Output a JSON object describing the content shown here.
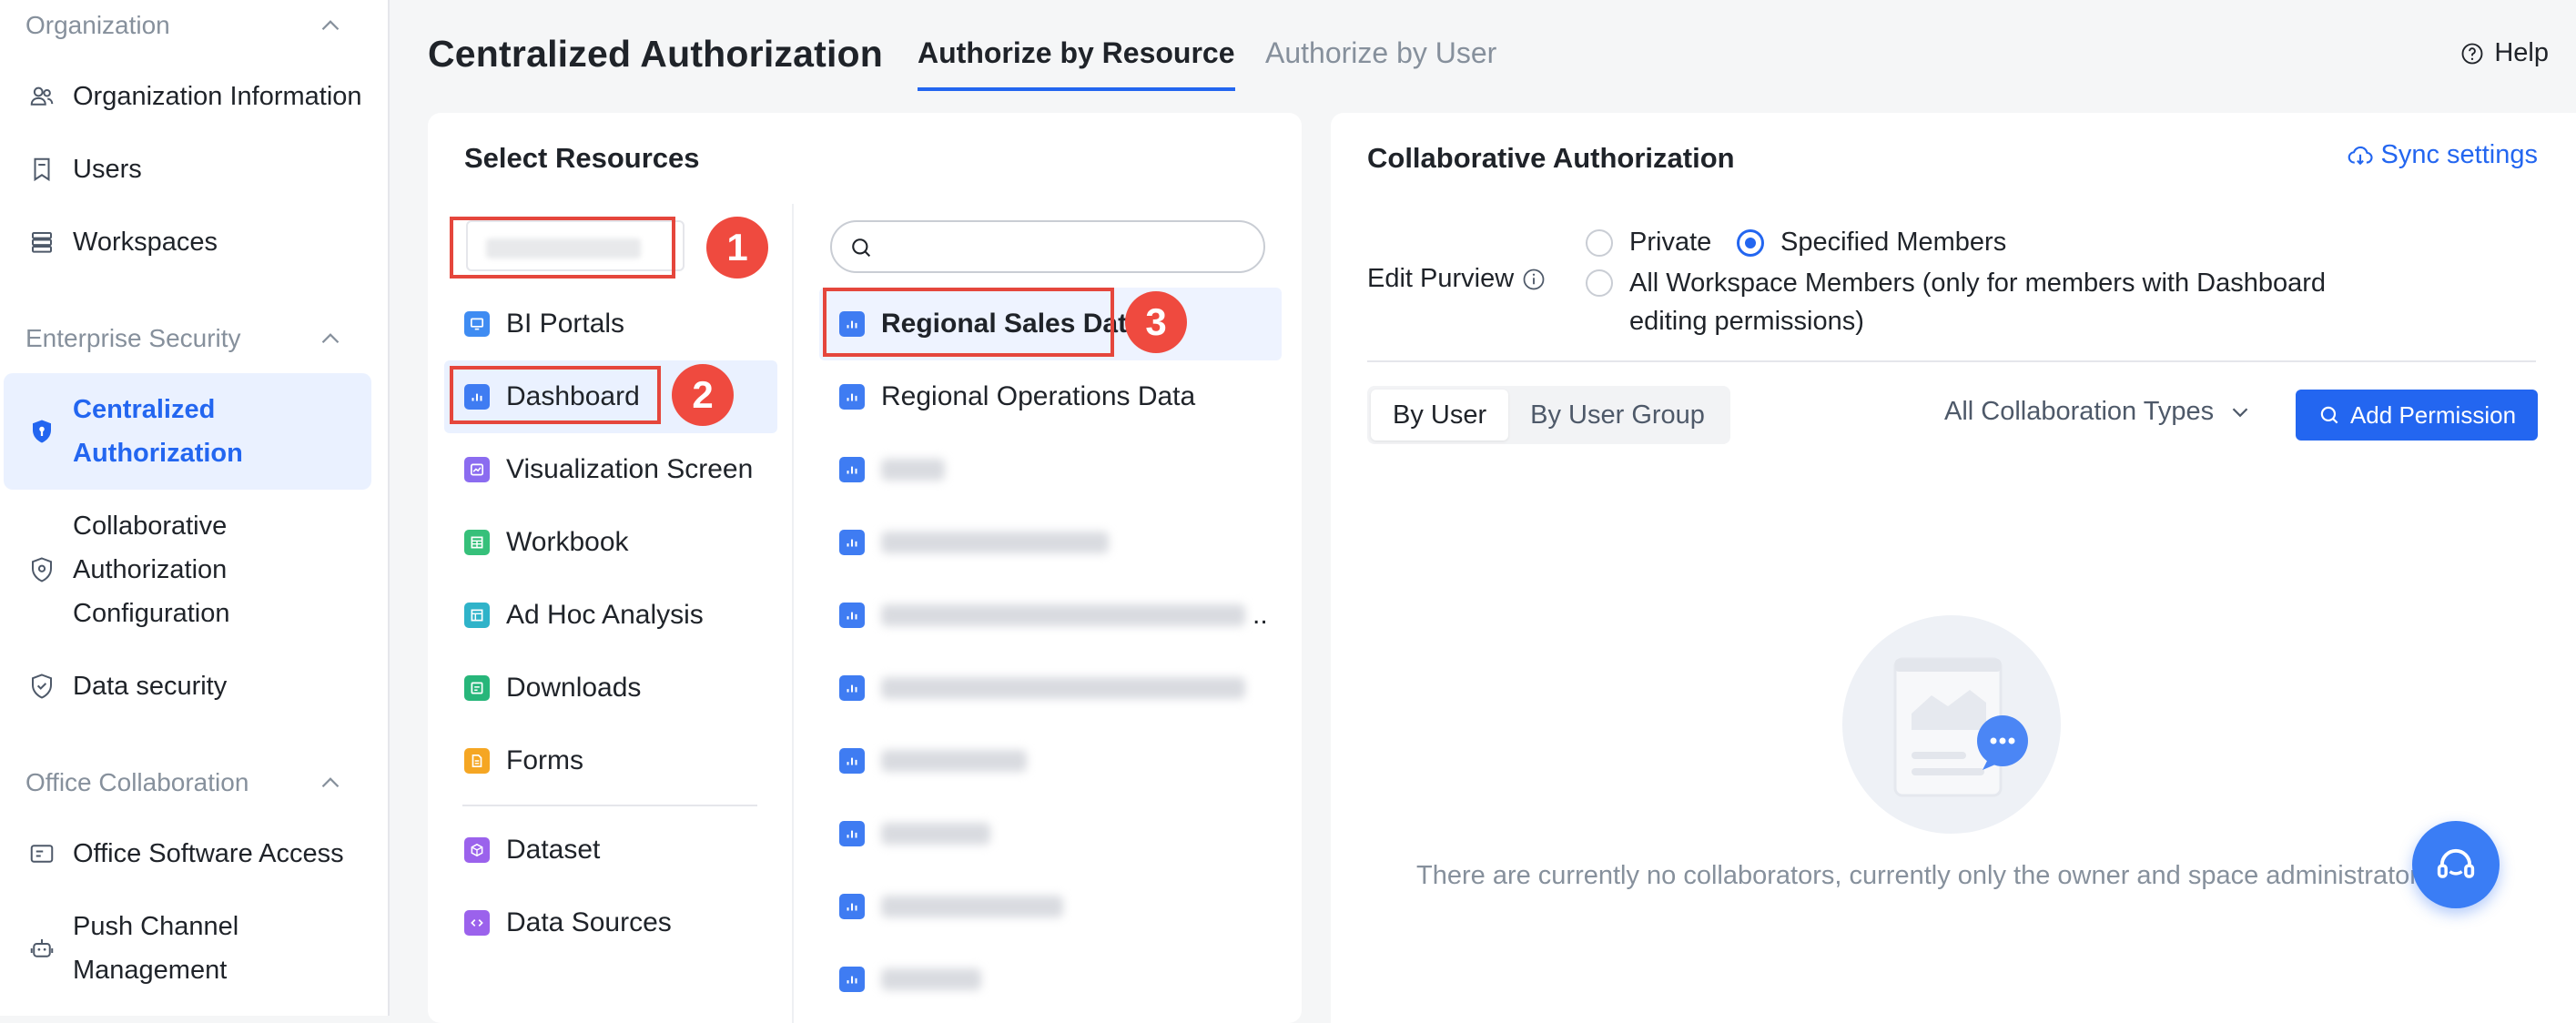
{
  "sidebar": {
    "groups": [
      {
        "label": "Organization"
      },
      {
        "label": "Enterprise Security"
      },
      {
        "label": "Office Collaboration"
      }
    ],
    "items": [
      {
        "label": "Organization Information",
        "icon": "users-group-icon"
      },
      {
        "label": "Users",
        "icon": "bookmark-icon"
      },
      {
        "label": "Workspaces",
        "icon": "stack-icon"
      },
      {
        "label": "Centralized Authorization",
        "icon": "shield-key-icon",
        "active": true
      },
      {
        "label": "Collaborative Authorization Configuration",
        "icon": "shield-gear-icon"
      },
      {
        "label": "Data security",
        "icon": "shield-check-icon"
      },
      {
        "label": "Office Software Access",
        "icon": "id-card-icon"
      },
      {
        "label": "Push Channel Management",
        "icon": "robot-icon"
      }
    ]
  },
  "header": {
    "title": "Centralized Authorization",
    "tabs": [
      {
        "label": "Authorize by Resource",
        "active": true
      },
      {
        "label": "Authorize by User",
        "active": false
      }
    ],
    "help": "Help"
  },
  "select_resources": {
    "title": "Select Resources",
    "types": [
      {
        "label": "BI Portals",
        "color": "#3f8cf2"
      },
      {
        "label": "Dashboard",
        "color": "#3f7cf2",
        "selected": true
      },
      {
        "label": "Visualization Screen",
        "color": "#8b6cf0"
      },
      {
        "label": "Workbook",
        "color": "#36c07a"
      },
      {
        "label": "Ad Hoc Analysis",
        "color": "#2fb3c9"
      },
      {
        "label": "Downloads",
        "color": "#27b67a"
      },
      {
        "label": "Forms",
        "color": "#f5a623"
      },
      {
        "label": "Dataset",
        "color": "#9b62ec"
      },
      {
        "label": "Data Sources",
        "color": "#9b62ec"
      }
    ],
    "resources": [
      {
        "label": "Regional Sales Data",
        "selected": true
      },
      {
        "label": "Regional Operations Data"
      }
    ],
    "truncated_ellipsis": ".."
  },
  "annotations": [
    "1",
    "2",
    "3"
  ],
  "collab": {
    "title": "Collaborative Authorization",
    "sync": "Sync settings",
    "edit_purview": "Edit Purview",
    "radio_private": "Private",
    "radio_specified": "Specified Members",
    "radio_all": "All Workspace Members (only for members with Dashboard editing permissions)",
    "selected_radio": "Specified Members",
    "by_user": "By User",
    "by_user_group": "By User Group",
    "collab_types": "All Collaboration Types",
    "add_permission": "Add Permission",
    "empty_text": "There are currently no collaborators, currently only the owner and space administrator ca"
  },
  "colors": {
    "accent": "#2366f0",
    "annotation_red": "#ef4a3f"
  }
}
